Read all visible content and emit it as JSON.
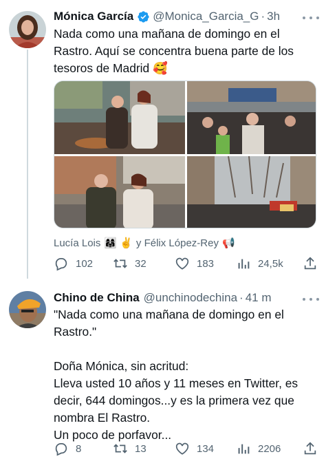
{
  "tweets": [
    {
      "author": {
        "name": "Mónica García",
        "handle": "@Monica_Garcia_G",
        "verified": true
      },
      "time": "3h",
      "text": "Nada como una mañana de domingo en el\nRastro. Aquí se concentra buena parte de los\ntesoros de Madrid 🥰",
      "photos": [
        "photo-1",
        "photo-2",
        "photo-3",
        "photo-4"
      ],
      "tags": {
        "first": "Lucía Lois",
        "first_emojis": "👩‍👩‍👧 ✌️",
        "connector": "y Félix López-Rey",
        "last_emoji": "📢"
      },
      "actions": {
        "replies": "102",
        "retweets": "32",
        "likes": "183",
        "views": "24,5k"
      }
    },
    {
      "author": {
        "name": "Chino de China",
        "handle": "@unchinodechina",
        "verified": false
      },
      "time": "41 m",
      "text": "\"Nada como una mañana de domingo en el\nRastro.\"\n\nDoña Mónica, sin acritud:\nLleva usted 10 años y 11 meses en Twitter, es\ndecir, 644 domingos...y es la primera vez que\nnombra El Rastro.\nUn poco de porfavor...",
      "actions": {
        "replies": "8",
        "retweets": "13",
        "likes": "134",
        "views": "2206"
      }
    }
  ],
  "colors": {
    "text": "#0f1419",
    "secondary": "#536471",
    "verified": "#1d9bf0",
    "line": "#cfd9de"
  },
  "icons": [
    "reply-icon",
    "retweet-icon",
    "like-icon",
    "views-icon",
    "share-icon",
    "verified-icon",
    "more-icon"
  ]
}
